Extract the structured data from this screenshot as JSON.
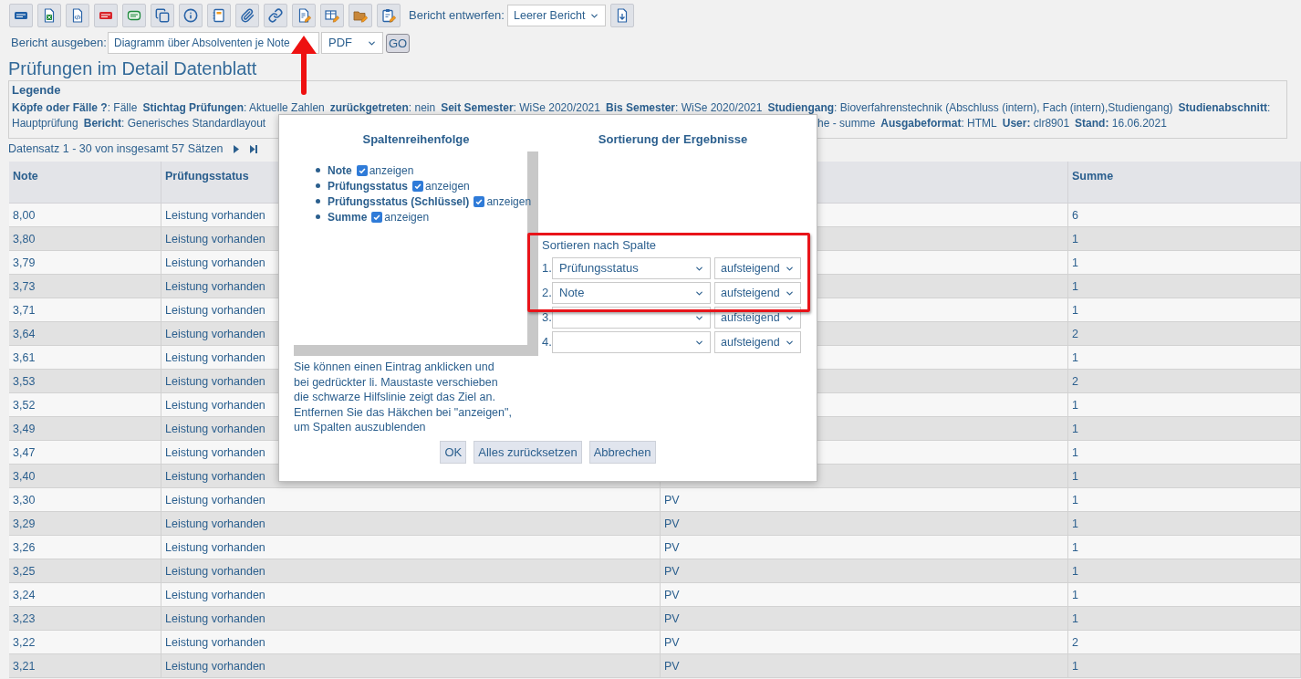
{
  "toolbar": {
    "design_label": "Bericht entwerfen:",
    "design_select": {
      "value": "Leerer Bericht"
    }
  },
  "output_row": {
    "label": "Bericht ausgeben:",
    "report_select": {
      "value": "Diagramm über Absolventen je Note"
    },
    "format_select": {
      "value": "PDF"
    },
    "go_button": "GO"
  },
  "title": "Prüfungen im Detail Datenblatt",
  "legend": {
    "title": "Legende",
    "line_1": [
      "**Köpfe oder Fälle ?**: Fälle",
      "**Stichtag Prüfungen**: Aktuelle Zahlen",
      "**zurückgetreten**: nein",
      "**Seit Semester**: WiSe 2020/2021",
      "**Bis Semester**: WiSe 2020/2021",
      "**Studiengang**: Bioverfahrenstechnik (Abschluss (intern), Fach (intern),Studiengang)",
      "**Studienabschnitt**:"
    ],
    "line_2_left": [
      "Hauptprüfung",
      "**Bericht**: Generisches Standardlayout"
    ],
    "line_2_right": [
      "he - summe",
      "**Ausgabeformat**: HTML",
      "**User:** clr8901",
      "**Stand:** 16.06.2021"
    ]
  },
  "pager": {
    "text": "Datensatz 1 - 30 von insgesamt 57 Sätzen"
  },
  "table": {
    "columns": [
      {
        "label": "Note"
      },
      {
        "label": "Prüfungsstatus"
      },
      {},
      {
        "label": "Summe"
      }
    ],
    "rows": [
      {
        "note": "8,00",
        "status": "Leistung vorhanden",
        "summe": "6"
      },
      {
        "note": "3,80",
        "status": "Leistung vorhanden",
        "summe": "1"
      },
      {
        "note": "3,79",
        "status": "Leistung vorhanden",
        "summe": "1"
      },
      {
        "note": "3,73",
        "status": "Leistung vorhanden",
        "summe": "1"
      },
      {
        "note": "3,71",
        "status": "Leistung vorhanden",
        "summe": "1"
      },
      {
        "note": "3,64",
        "status": "Leistung vorhanden",
        "summe": "2"
      },
      {
        "note": "3,61",
        "status": "Leistung vorhanden",
        "summe": "1"
      },
      {
        "note": "3,53",
        "status": "Leistung vorhanden",
        "summe": "2"
      },
      {
        "note": "3,52",
        "status": "Leistung vorhanden",
        "summe": "1"
      },
      {
        "note": "3,49",
        "status": "Leistung vorhanden",
        "summe": "1"
      },
      {
        "note": "3,47",
        "status": "Leistung vorhanden",
        "summe": "1"
      },
      {
        "note": "3,40",
        "status": "Leistung vorhanden",
        "summe": "1"
      },
      {
        "note": "3,30",
        "status": "Leistung vorhanden",
        "column_3": "PV",
        "summe": "1"
      },
      {
        "note": "3,29",
        "status": "Leistung vorhanden",
        "column_3": "PV",
        "summe": "1"
      },
      {
        "note": "3,26",
        "status": "Leistung vorhanden",
        "column_3": "PV",
        "summe": "1"
      },
      {
        "note": "3,25",
        "status": "Leistung vorhanden",
        "column_3": "PV",
        "summe": "1"
      },
      {
        "note": "3,24",
        "status": "Leistung vorhanden",
        "column_3": "PV",
        "summe": "1"
      },
      {
        "note": "3,23",
        "status": "Leistung vorhanden",
        "column_3": "PV",
        "summe": "1"
      },
      {
        "note": "3,22",
        "status": "Leistung vorhanden",
        "column_3": "PV",
        "summe": "2"
      },
      {
        "note": "3,21",
        "status": "Leistung vorhanden",
        "column_3": "PV",
        "summe": "1"
      }
    ]
  },
  "dialog": {
    "column_order": {
      "title": "Spaltenreihenfolge",
      "items": [
        {
          "label": "Note",
          "show_label": "anzeigen",
          "checked": true
        },
        {
          "label": "Prüfungsstatus",
          "show_label": "anzeigen",
          "checked": true
        },
        {
          "label": "Prüfungsstatus (Schlüssel)",
          "show_label": "anzeigen",
          "checked": true
        },
        {
          "label": "Summe",
          "show_label": "anzeigen",
          "checked": true
        }
      ]
    },
    "help_text": [
      "Sie können einen Eintrag anklicken und",
      "bei gedrückter li. Maustaste verschieben",
      "die schwarze Hilfslinie zeigt das Ziel an.",
      "Entfernen Sie das Häkchen bei \"anzeigen\",",
      "um Spalten auszublenden"
    ],
    "sorting": {
      "title": "Sortierung der Ergebnisse",
      "label": "Sortieren nach Spalte",
      "rows": [
        {
          "number": "1.",
          "column": "Prüfungsstatus",
          "order": "aufsteigend"
        },
        {
          "number": "2.",
          "column": "Note",
          "order": "aufsteigend"
        },
        {
          "number": "3.",
          "order": "aufsteigend"
        },
        {
          "number": "4.",
          "order": "aufsteigend"
        }
      ]
    },
    "buttons": [
      "OK",
      "Alles zurücksetzen",
      "Abbrechen"
    ]
  }
}
